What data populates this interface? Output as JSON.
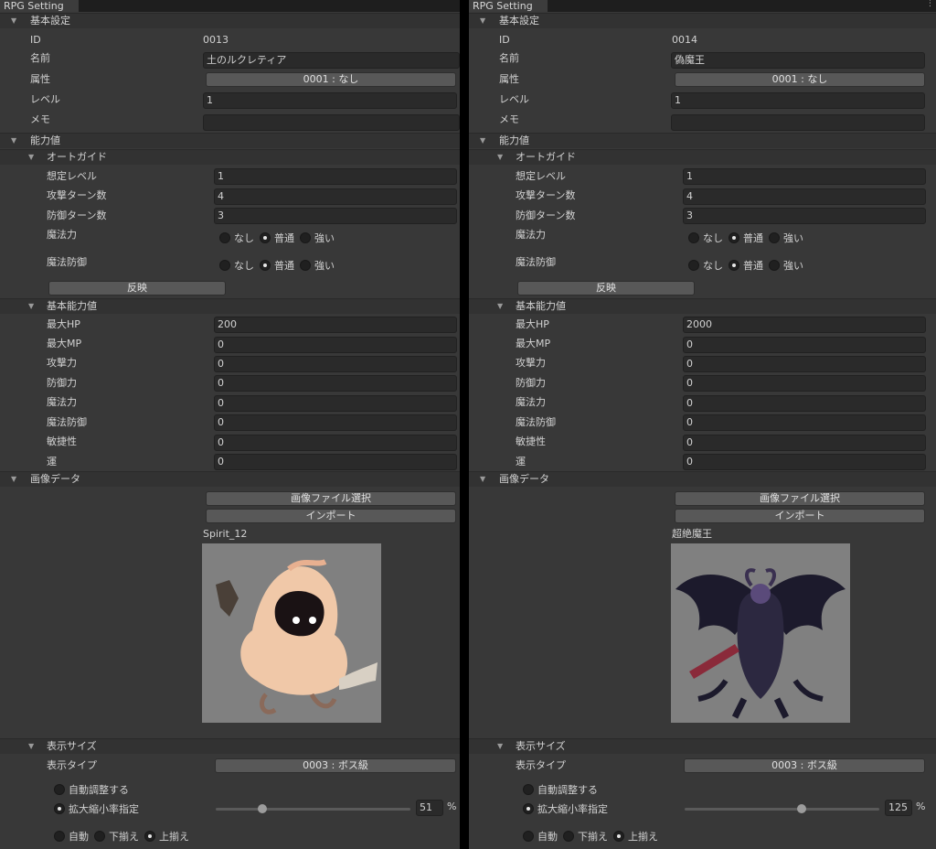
{
  "panels": [
    {
      "tab_title": "RPG Setting",
      "basic_section": "基本設定",
      "id_label": "ID",
      "id_value": "0013",
      "name_label": "名前",
      "name_value": "土のルクレティア",
      "attr_label": "属性",
      "attr_value": "0001 : なし",
      "level_label": "レベル",
      "level_value": "1",
      "memo_label": "メモ",
      "memo_value": "",
      "ability_section": "能力値",
      "autoguide_section": "オートガイド",
      "assumed_level_label": "想定レベル",
      "assumed_level_value": "1",
      "atk_turns_label": "攻撃ターン数",
      "atk_turns_value": "4",
      "def_turns_label": "防御ターン数",
      "def_turns_value": "3",
      "magic_power_label": "魔法力",
      "magic_defense_label": "魔法防御",
      "opt_none": "なし",
      "opt_normal": "普通",
      "opt_strong": "強い",
      "magic_power_selected": "普通",
      "magic_defense_selected": "普通",
      "apply_button": "反映",
      "base_section": "基本能力値",
      "stats": [
        {
          "label": "最大HP",
          "value": "200"
        },
        {
          "label": "最大MP",
          "value": "0"
        },
        {
          "label": "攻撃力",
          "value": "0"
        },
        {
          "label": "防御力",
          "value": "0"
        },
        {
          "label": "魔法力",
          "value": "0"
        },
        {
          "label": "魔法防御",
          "value": "0"
        },
        {
          "label": "敏捷性",
          "value": "0"
        },
        {
          "label": "運",
          "value": "0"
        }
      ],
      "image_section": "画像データ",
      "select_file_button": "画像ファイル選択",
      "import_button": "インポート",
      "image_name": "Spirit_12",
      "display_size_section": "表示サイズ",
      "display_type_label": "表示タイプ",
      "display_type_value": "0003 : ボス級",
      "auto_adjust_label": "自動調整する",
      "scale_label": "拡大縮小率指定",
      "scale_mode": "scale",
      "scale_value": "51",
      "scale_fraction": 0.24,
      "percent": "%",
      "align_auto": "自動",
      "align_bottom": "下揃え",
      "align_top": "上揃え",
      "align_selected": "top"
    },
    {
      "tab_title": "RPG Setting",
      "basic_section": "基本設定",
      "id_label": "ID",
      "id_value": "0014",
      "name_label": "名前",
      "name_value": "偽魔王",
      "attr_label": "属性",
      "attr_value": "0001 : なし",
      "level_label": "レベル",
      "level_value": "1",
      "memo_label": "メモ",
      "memo_value": "",
      "ability_section": "能力値",
      "autoguide_section": "オートガイド",
      "assumed_level_label": "想定レベル",
      "assumed_level_value": "1",
      "atk_turns_label": "攻撃ターン数",
      "atk_turns_value": "4",
      "def_turns_label": "防御ターン数",
      "def_turns_value": "3",
      "magic_power_label": "魔法力",
      "magic_defense_label": "魔法防御",
      "opt_none": "なし",
      "opt_normal": "普通",
      "opt_strong": "強い",
      "magic_power_selected": "普通",
      "magic_defense_selected": "普通",
      "apply_button": "反映",
      "base_section": "基本能力値",
      "stats": [
        {
          "label": "最大HP",
          "value": "2000"
        },
        {
          "label": "最大MP",
          "value": "0"
        },
        {
          "label": "攻撃力",
          "value": "0"
        },
        {
          "label": "防御力",
          "value": "0"
        },
        {
          "label": "魔法力",
          "value": "0"
        },
        {
          "label": "魔法防御",
          "value": "0"
        },
        {
          "label": "敏捷性",
          "value": "0"
        },
        {
          "label": "運",
          "value": "0"
        }
      ],
      "image_section": "画像データ",
      "select_file_button": "画像ファイル選択",
      "import_button": "インポート",
      "image_name": "超絶魔王",
      "display_size_section": "表示サイズ",
      "display_type_label": "表示タイプ",
      "display_type_value": "0003 : ボス級",
      "auto_adjust_label": "自動調整する",
      "scale_label": "拡大縮小率指定",
      "scale_mode": "scale",
      "scale_value": "125",
      "scale_fraction": 0.6,
      "percent": "%",
      "align_auto": "自動",
      "align_bottom": "下揃え",
      "align_top": "上揃え",
      "align_selected": "top"
    }
  ],
  "colors": {
    "panel_bg": "#383838",
    "field_bg": "#2a2a2a",
    "button_bg": "#585858",
    "image_bg": "#808080"
  }
}
